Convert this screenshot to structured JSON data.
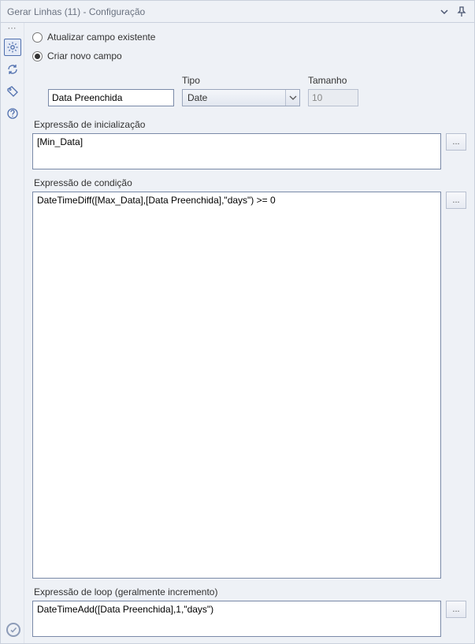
{
  "title": "Gerar Linhas (11) - Configuração",
  "sidebar": {
    "items": [
      {
        "name": "gear-icon",
        "selected": true
      },
      {
        "name": "refresh-arrows-icon",
        "selected": false
      },
      {
        "name": "tag-icon",
        "selected": false
      },
      {
        "name": "help-icon",
        "selected": false
      }
    ]
  },
  "mode": {
    "update_label": "Atualizar campo existente",
    "create_label": "Criar novo campo",
    "selected": "create"
  },
  "field": {
    "name_value": "Data Preenchida",
    "type_label": "Tipo",
    "type_value": "Date",
    "size_label": "Tamanho",
    "size_value": "10"
  },
  "sections": {
    "init_label": "Expressão de inicialização",
    "init_value": "[Min_Data]",
    "cond_label": "Expressão de condição",
    "cond_value": "DateTimeDiff([Max_Data],[Data Preenchida],\"days\") >= 0",
    "loop_label": "Expressão de loop (geralmente incremento)",
    "loop_value": "DateTimeAdd([Data Preenchida],1,\"days\")",
    "ellipsis": "..."
  }
}
